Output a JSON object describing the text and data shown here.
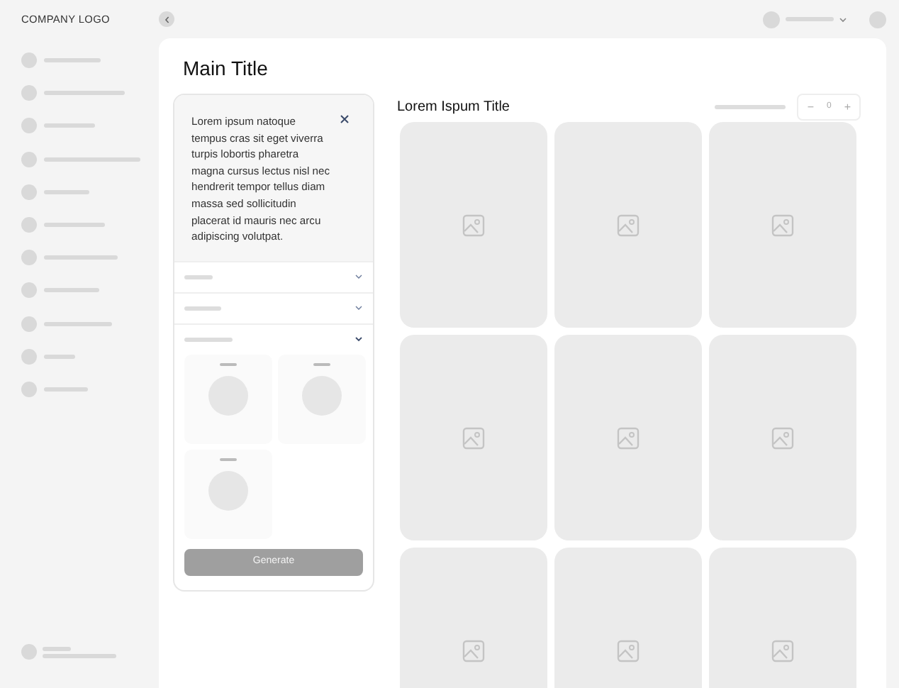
{
  "logo": "COMPANY LOGO",
  "main_title": "Main Title",
  "info_card": {
    "text": "Lorem ipsum natoque tempus cras sit eget viverra turpis lobortis pharetra magna cursus lectus nisl nec hendrerit tempor tellus diam massa sed sollicitudin placerat id mauris nec arcu adipiscing volutpat.",
    "sections": [
      {
        "expanded": false
      },
      {
        "expanded": false
      },
      {
        "expanded": true,
        "options": [
          {
            "kind": "circle"
          },
          {
            "kind": "circle"
          },
          {
            "kind": "circle"
          }
        ]
      }
    ],
    "button": "Generate"
  },
  "gallery": {
    "title": "Lorem Ispum Title",
    "stepper": {
      "minus": "−",
      "value": "0",
      "plus": "+"
    }
  }
}
